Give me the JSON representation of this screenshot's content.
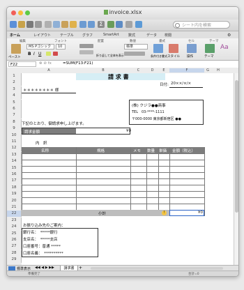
{
  "window": {
    "title": "invoice.xlsx"
  },
  "toolbar": {
    "search_placeholder": "シート内を検索"
  },
  "ribbon_tabs": [
    "ホーム",
    "レイアウト",
    "テーブル",
    "グラフ",
    "SmartArt",
    "数式",
    "データ",
    "校閲"
  ],
  "ribbon_groups": [
    "編集",
    "フォント",
    "配置",
    "数値",
    "書式",
    "セル",
    "テーマ"
  ],
  "ribbon": {
    "paste_label": "ペースト",
    "font_name": "MS Pゴシック",
    "font_size": "10",
    "number_format": "標準",
    "styles_label": "スタイル",
    "conditional_label": "条件付き書式",
    "actions_label": "操作",
    "themes_label": "テーマ",
    "wrap_label": "折り返して全体を表示"
  },
  "formula_bar": {
    "cell_ref": "F22",
    "formula": "=SUM(F13:F21)"
  },
  "columns": [
    "A",
    "B",
    "C",
    "D",
    "E",
    "F",
    "G",
    "H"
  ],
  "rows": [
    "1",
    "2",
    "3",
    "4",
    "5",
    "6",
    "7",
    "8",
    "9",
    "10",
    "11",
    "12",
    "13",
    "14",
    "15",
    "16",
    "17",
    "18",
    "19",
    "20",
    "21",
    "22",
    "23",
    "24",
    "25",
    "26",
    "27",
    "28",
    "29"
  ],
  "invoice": {
    "title": "請 求 書",
    "date_label": "日付:",
    "date_value": "20××/×/×",
    "customer": "＊＊＊＊＊＊＊＊ 様",
    "company_name": "(株) クジラ●●商事",
    "company_tel": "TEL　03-****-1111",
    "company_address": "〒000-0000 東京都新宿区 ●●",
    "intro": "下記のとおり、御請求申し上げます。",
    "amount_label": "請求金額",
    "amount_value": "¥0",
    "details_label": "内　訳",
    "table_headers": [
      "名称",
      "規格",
      "メモ",
      "数量",
      "単価",
      "金額（税込）"
    ],
    "subtotal_label": "小計",
    "subtotal_value": "¥0",
    "bank_header": "お振り込み先のご案内：",
    "bank_lines": [
      "銀行名：　*****銀行",
      "支店名：　*****支店",
      "口座番号：普通 *****",
      "口座名義：　**********"
    ]
  },
  "sheet_tabs": [
    "請求書"
  ],
  "view_labels": [
    "標準表示"
  ],
  "status": {
    "mode": "準備完了",
    "sum_label": "合計=0"
  },
  "colors": {
    "title_fill": "#d6eef5",
    "header_fill": "#7d7d7d",
    "selected": "#2a63c6"
  }
}
